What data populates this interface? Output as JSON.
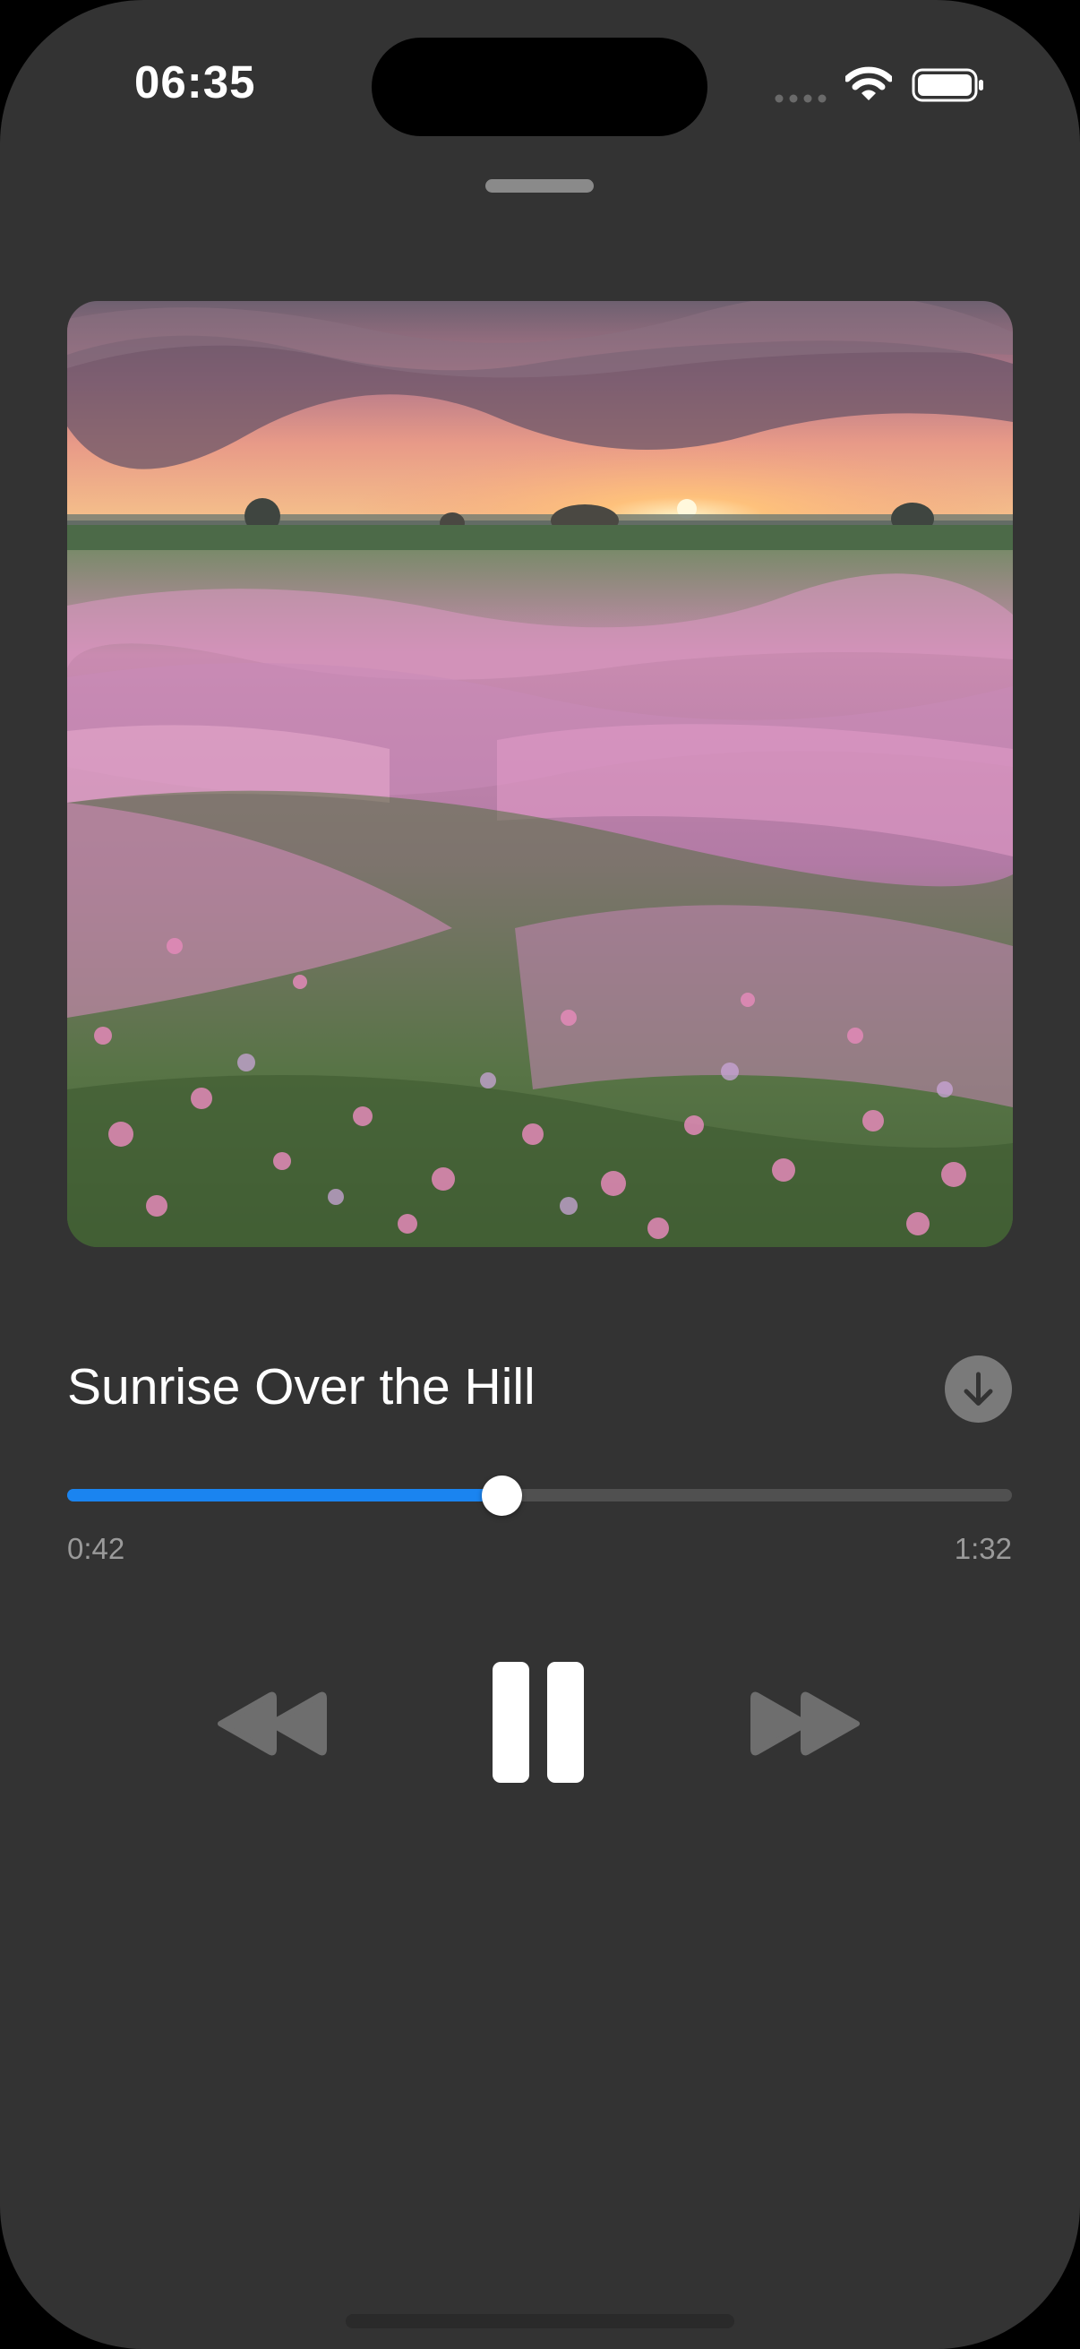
{
  "status_bar": {
    "time": "06:35",
    "signal": "signal-dots-icon",
    "wifi": "wifi-icon",
    "battery": "battery-icon"
  },
  "player": {
    "artwork": "sunset-flower-field-image",
    "track_title": "Sunrise Over the Hill",
    "download_icon": "download-arrow-icon",
    "elapsed": "0:42",
    "total": "1:32",
    "progress_fraction": 0.46,
    "controls": {
      "rewind": "rewind-icon",
      "pause": "pause-icon",
      "forward": "fast-forward-icon"
    }
  },
  "colors": {
    "background": "#333333",
    "accent": "#1a84f0",
    "track_inactive": "#505050",
    "secondary_text": "#9a9a9a",
    "inactive_control": "#6e6e6e"
  }
}
